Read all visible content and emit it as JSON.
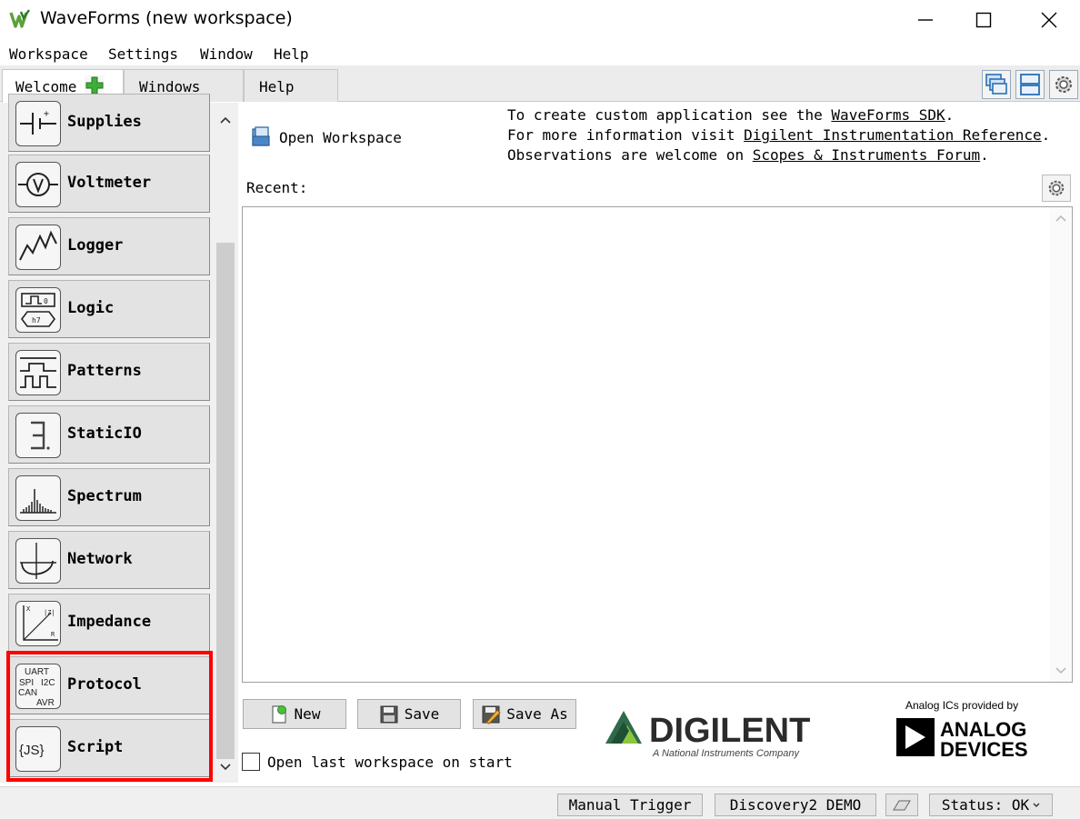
{
  "window": {
    "title": "WaveForms (new workspace)",
    "brand_color": "#5aa13a"
  },
  "menu": [
    "Workspace",
    "Settings",
    "Window",
    "Help"
  ],
  "tabs": [
    {
      "label": "Welcome",
      "active": true
    },
    {
      "label": "Windows",
      "active": false
    },
    {
      "label": "Help",
      "active": false
    }
  ],
  "instruments": [
    {
      "label": "Supplies",
      "icon": "supplies-icon"
    },
    {
      "label": "Voltmeter",
      "icon": "voltmeter-icon"
    },
    {
      "label": "Logger",
      "icon": "logger-icon"
    },
    {
      "label": "Logic",
      "icon": "logic-icon"
    },
    {
      "label": "Patterns",
      "icon": "patterns-icon"
    },
    {
      "label": "StaticIO",
      "icon": "staticio-icon"
    },
    {
      "label": "Spectrum",
      "icon": "spectrum-icon"
    },
    {
      "label": "Network",
      "icon": "network-icon"
    },
    {
      "label": "Impedance",
      "icon": "impedance-icon"
    },
    {
      "label": "Protocol",
      "icon": "protocol-icon"
    },
    {
      "label": "Script",
      "icon": "script-icon"
    }
  ],
  "icon_text": {
    "logic_top": "0",
    "logic_bottom": "h7",
    "impedance_x": "X",
    "impedance_z": "|Z|",
    "impedance_r": "R",
    "protocol_uart": "UART",
    "protocol_spi": "SPI",
    "protocol_i2c": "I2C",
    "protocol_can": "CAN",
    "protocol_avr": "AVR",
    "script_js": "{JS}"
  },
  "welcome": {
    "open_workspace": "Open Workspace",
    "info_lines": [
      {
        "prefix": "To create custom application see the ",
        "link": "WaveForms SDK",
        "suffix": "."
      },
      {
        "prefix": "For more information visit ",
        "link": "Digilent Instrumentation Reference",
        "suffix": "."
      },
      {
        "prefix": "Observations are welcome on ",
        "link": "Scopes & Instruments Forum",
        "suffix": "."
      }
    ],
    "recent_label": "Recent:",
    "buttons": {
      "new": "New",
      "save": "Save",
      "save_as": "Save As"
    },
    "checkbox_label": "Open last workspace on start",
    "checkbox_checked": false
  },
  "logos": {
    "digilent_name": "DIGILENT",
    "digilent_tagline": "A National Instruments Company",
    "adi_caption": "Analog ICs provided by",
    "adi_line1": "ANALOG",
    "adi_line2": "DEVICES",
    "digilent_color": "#2f6b4a"
  },
  "status": {
    "trigger": "Manual Trigger",
    "device": "Discovery2 DEMO",
    "status": "Status: OK"
  },
  "highlight_color": "#ff0000"
}
